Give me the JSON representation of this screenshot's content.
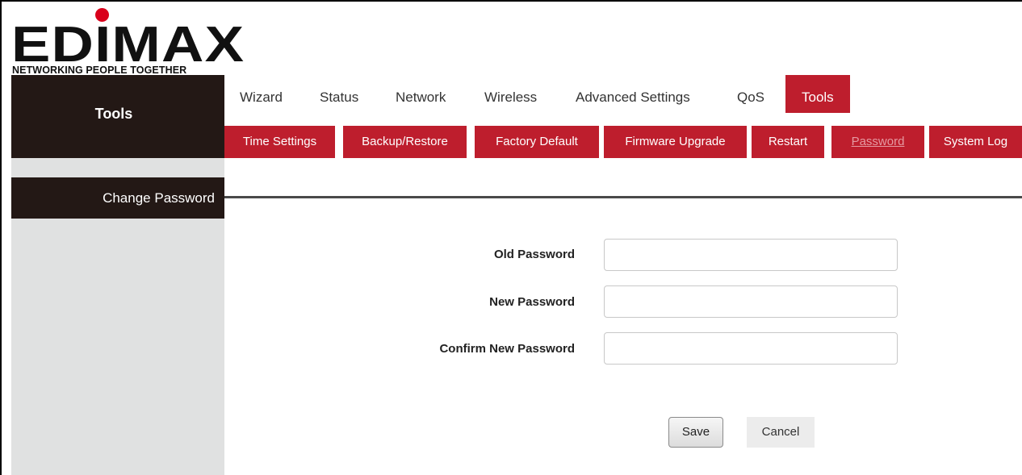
{
  "brand": {
    "logo_text": "EDIMAX",
    "tagline": "NETWORKING PEOPLE TOGETHER",
    "accent_color": "#d9001b"
  },
  "sidebar": {
    "header": "Tools",
    "items": [
      {
        "label": "Change Password"
      }
    ]
  },
  "top_nav": {
    "items": [
      {
        "label": "Wizard"
      },
      {
        "label": "Status"
      },
      {
        "label": "Network"
      },
      {
        "label": "Wireless"
      },
      {
        "label": "Advanced Settings"
      },
      {
        "label": "QoS"
      },
      {
        "label": "Tools"
      }
    ],
    "active": "Tools",
    "active_color": "#be1e2d"
  },
  "sub_nav": {
    "items": [
      {
        "label": "Time Settings"
      },
      {
        "label": "Backup/Restore"
      },
      {
        "label": "Factory Default"
      },
      {
        "label": "Firmware Upgrade"
      },
      {
        "label": "Restart"
      },
      {
        "label": "Password"
      },
      {
        "label": "System Log"
      }
    ],
    "current": "Password"
  },
  "form": {
    "old_password": {
      "label": "Old Password",
      "value": ""
    },
    "new_password": {
      "label": "New Password",
      "value": ""
    },
    "confirm_password": {
      "label": "Confirm New Password",
      "value": ""
    }
  },
  "buttons": {
    "save": "Save",
    "cancel": "Cancel"
  }
}
